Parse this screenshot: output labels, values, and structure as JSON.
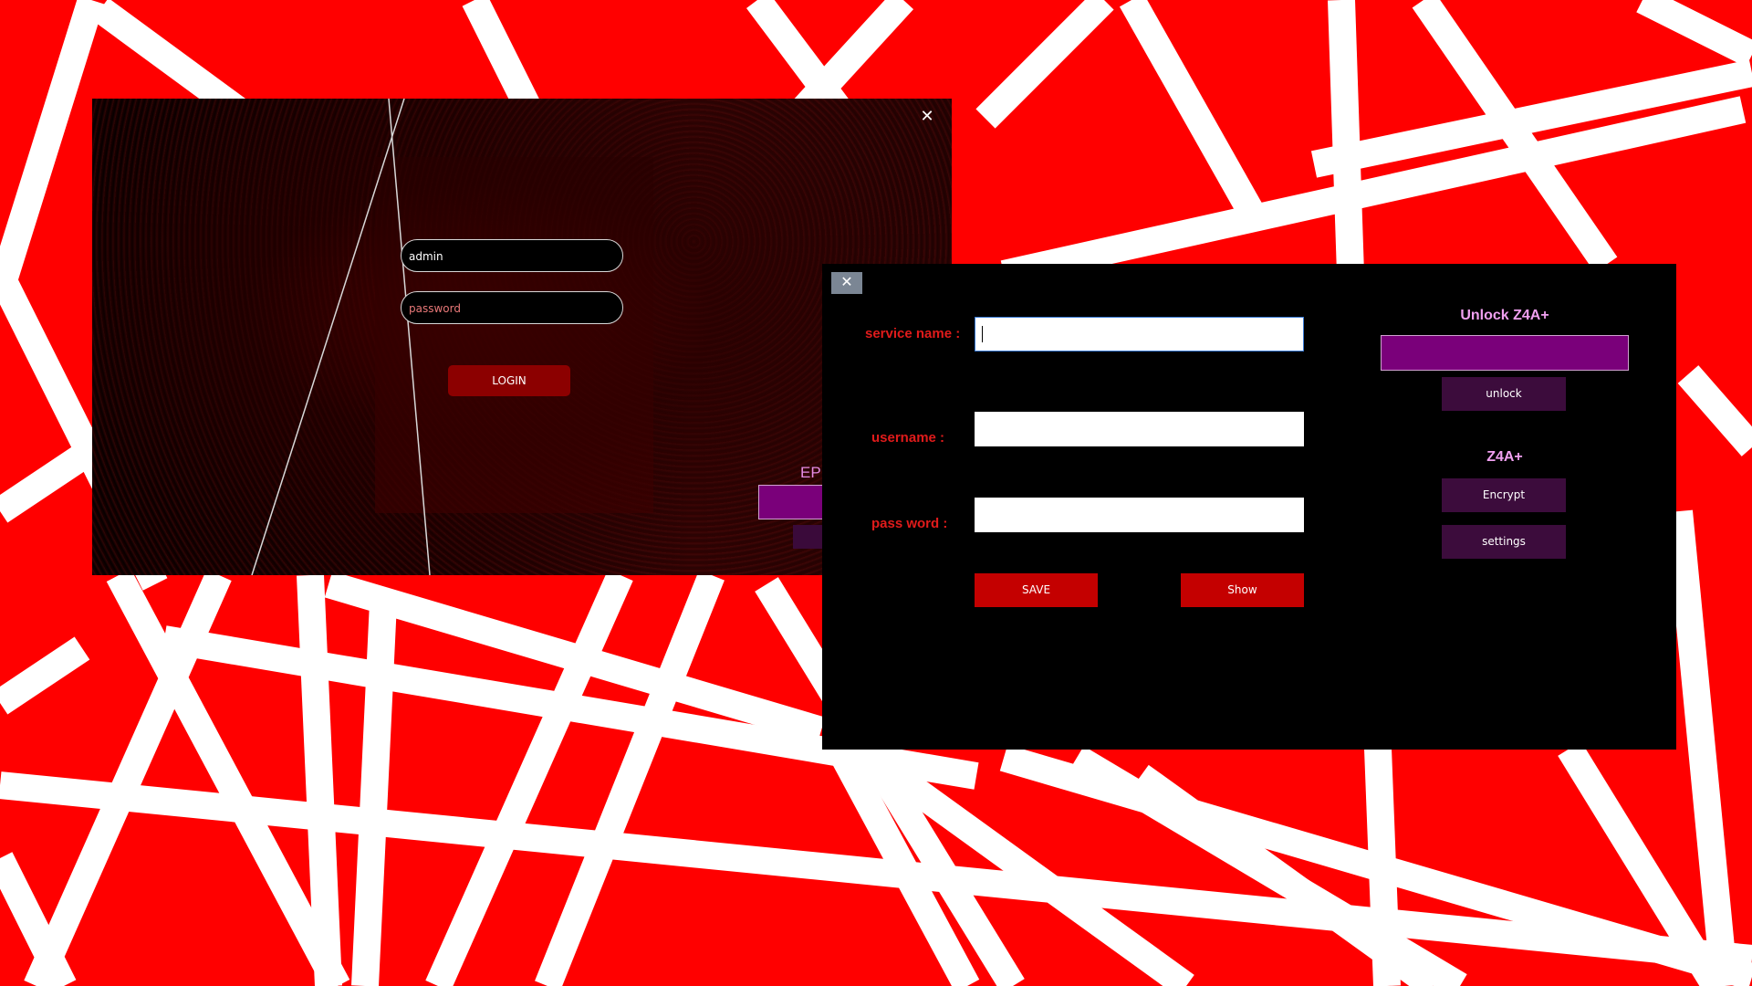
{
  "login_window": {
    "close_glyph": "✕",
    "username_value": "admin",
    "password_placeholder": "password",
    "login_label": "LOGIN",
    "partial_label": "EP"
  },
  "vault_window": {
    "close_glyph": "✕",
    "service_name_label": "service name :",
    "username_label": "username :",
    "password_label": "pass word :",
    "service_name_value": "",
    "username_value": "",
    "password_value": "",
    "save_label": "SAVE",
    "show_label": "Show",
    "unlock_heading": "Unlock Z4A+",
    "unlock_label": "unlock",
    "z4a_heading": "Z4A+",
    "encrypt_label": "Encrypt",
    "settings_label": "settings"
  },
  "colors": {
    "wallpaper_red": "#ff0000",
    "stripe_white": "#ffffff",
    "accent_purple": "#7a007a",
    "label_red": "#e01b1b",
    "button_red": "#c40000",
    "heading_pink": "#f0a0f0"
  },
  "icons": {
    "close": "close-icon"
  }
}
